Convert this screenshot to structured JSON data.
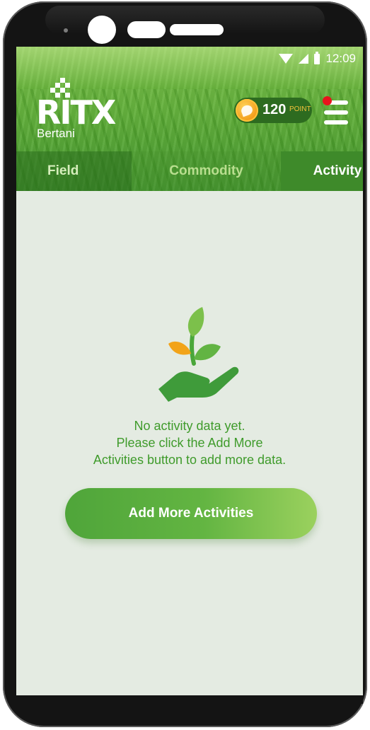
{
  "status_bar": {
    "time": "12:09",
    "icons": [
      "wifi-icon",
      "signal-icon",
      "battery-icon"
    ]
  },
  "brand": {
    "logo_text": "RITX",
    "logo_subtitle": "Bertani"
  },
  "points": {
    "value": "120",
    "unit": "POINT",
    "icon": "coin-icon"
  },
  "menu": {
    "icon": "hamburger-menu-icon",
    "has_notification": true,
    "notification_color": "#e8141c"
  },
  "tabs": [
    {
      "label": "Field",
      "active": false
    },
    {
      "label": "Commodity",
      "active": false
    },
    {
      "label": "Activity",
      "active": true
    }
  ],
  "empty_state": {
    "icon": "plant-in-hand-icon",
    "line1": "No activity data yet.",
    "line2": "Please click the Add More",
    "line3": "Activities button to add more data."
  },
  "actions": {
    "add_more_label": "Add More Activities"
  },
  "colors": {
    "brand_green": "#4fa53a",
    "text_green": "#3f9b2b",
    "accent_orange": "#f29a17",
    "background": "#e4ebe2"
  }
}
